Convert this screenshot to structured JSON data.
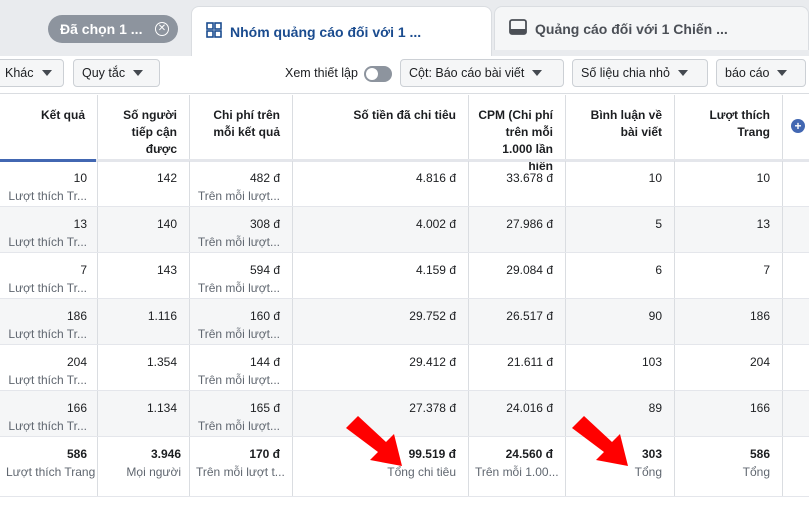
{
  "tabs": {
    "selected_pill": "Đã chọn 1 ...",
    "active": "Nhóm quảng cáo đối với 1 ...",
    "inactive": "Quảng cáo đối với 1 Chiến ..."
  },
  "toolbar": {
    "khac": "Khác",
    "quy_tac": "Quy tắc",
    "xem_thiet_lap": "Xem thiết lập",
    "cot": "Cột: Báo cáo bài viết",
    "so_lieu": "Số liệu chia nhỏ",
    "bao_cao": "báo cáo"
  },
  "columns": [
    "Kết quả",
    "Số người tiếp cận được",
    "Chi phí trên mỗi kết quả",
    "Số tiền đã chi tiêu",
    "CPM (Chi phí trên mỗi 1.000 lần hiển",
    "Bình luận về bài viết",
    "Lượt thích Trang"
  ],
  "rows": [
    [
      "10",
      "Lượt thích Tr...",
      "142",
      "482 đ",
      "Trên mỗi lượt...",
      "4.816 đ",
      "33.678 đ",
      "10",
      "10"
    ],
    [
      "13",
      "Lượt thích Tr...",
      "140",
      "308 đ",
      "Trên mỗi lượt...",
      "4.002 đ",
      "27.986 đ",
      "5",
      "13"
    ],
    [
      "7",
      "Lượt thích Tr...",
      "143",
      "594 đ",
      "Trên mỗi lượt...",
      "4.159 đ",
      "29.084 đ",
      "6",
      "7"
    ],
    [
      "186",
      "Lượt thích Tr...",
      "1.116",
      "160 đ",
      "Trên mỗi lượt...",
      "29.752 đ",
      "26.517 đ",
      "90",
      "186"
    ],
    [
      "204",
      "Lượt thích Tr...",
      "1.354",
      "144 đ",
      "Trên mỗi lượt...",
      "29.412 đ",
      "21.611 đ",
      "103",
      "204"
    ],
    [
      "166",
      "Lượt thích Tr...",
      "1.134",
      "165 đ",
      "Trên mỗi lượt...",
      "27.378 đ",
      "24.016 đ",
      "89",
      "166"
    ]
  ],
  "totals": {
    "ket_qua": "586",
    "ket_qua_sub": "Lượt thích Trang",
    "reach": "3.946",
    "reach_sub": "Mọi người",
    "cost_per": "170 đ",
    "cost_per_sub": "Trên mỗi lượt t...",
    "spend": "99.519 đ",
    "spend_sub": "Tổng chi tiêu",
    "cpm": "24.560 đ",
    "cpm_sub": "Trên mỗi 1.00...",
    "comments": "303",
    "comments_sub": "Tổng",
    "likes": "586",
    "likes_sub": "Tổng"
  },
  "colors": {
    "accent": "#4267b2",
    "arrow": "#ff0000",
    "tab_text": "#1b4c8f"
  }
}
